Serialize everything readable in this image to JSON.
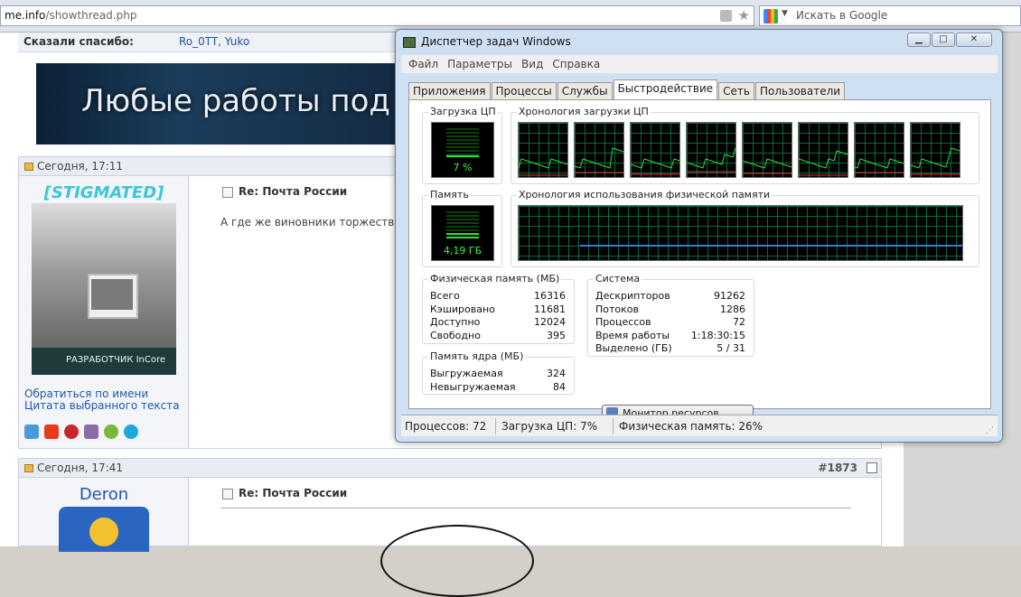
{
  "browser": {
    "url_host": "me.info",
    "url_path": "/showthread.php",
    "search_placeholder": "Искать в Google"
  },
  "forum": {
    "thanks_label": "Сказали спасибо:",
    "thanks_users": "Ro_0TT, Yuko",
    "banner_text": "Любые работы под",
    "post1": {
      "date": "Сегодня, 17:11",
      "username": "[STIGMATED]",
      "badge": "РАЗРАБОТЧИК InCore",
      "title": "Re: Почта России",
      "text": "А где же виновники торжеств",
      "link1": "Обратиться по имени",
      "link2": "Цитата выбранного текста"
    },
    "post2": {
      "date": "Сегодня, 17:41",
      "number": "#1873",
      "username": "Deron",
      "title": "Re: Почта России"
    }
  },
  "taskmgr": {
    "title": "Диспетчер задач Windows",
    "menu": [
      "Файл",
      "Параметры",
      "Вид",
      "Справка"
    ],
    "tabs": [
      "Приложения",
      "Процессы",
      "Службы",
      "Быстродействие",
      "Сеть",
      "Пользователи"
    ],
    "active_tab": "Быстродействие",
    "cpu_label": "Загрузка ЦП",
    "cpu_value": "7 %",
    "cpu_fraction": 0.07,
    "cpu_history_label": "Хронология загрузки ЦП",
    "cpu_cores": 8,
    "mem_label": "Память",
    "mem_value": "4,19 ГБ",
    "mem_fraction": 0.26,
    "mem_history_label": "Хронология использования физической памяти",
    "physmem": {
      "title": "Физическая память (МБ)",
      "rows": [
        {
          "k": "Всего",
          "v": "16316"
        },
        {
          "k": "Кэшировано",
          "v": "11681"
        },
        {
          "k": "Доступно",
          "v": "12024"
        },
        {
          "k": "Свободно",
          "v": "395"
        }
      ]
    },
    "kernel": {
      "title": "Память ядра (МБ)",
      "rows": [
        {
          "k": "Выгружаемая",
          "v": "324"
        },
        {
          "k": "Невыгружаемая",
          "v": "84"
        }
      ]
    },
    "system": {
      "title": "Система",
      "rows": [
        {
          "k": "Дескрипторов",
          "v": "91262"
        },
        {
          "k": "Потоков",
          "v": "1286"
        },
        {
          "k": "Процессов",
          "v": "72"
        },
        {
          "k": "Время работы",
          "v": "1:18:30:15"
        },
        {
          "k": "Выделено (ГБ)",
          "v": "5 / 31"
        }
      ]
    },
    "resource_button": "Монитор ресурсов...",
    "status": {
      "processes": "Процессов: 72",
      "cpu": "Загрузка ЦП: 7%",
      "mem": "Физическая память: 26%"
    }
  }
}
